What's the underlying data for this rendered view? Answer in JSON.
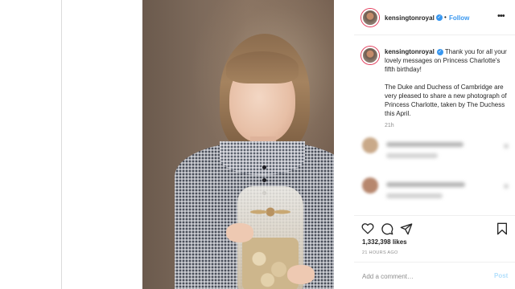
{
  "post": {
    "username": "kensingtonroyal",
    "follow_label": "Follow",
    "dot": "•",
    "more_label": "•••",
    "caption_p1": "Thank you for all your lovely messages on Princess Charlotte's fifth birthday!",
    "caption_p2": "The Duke and Duchess of Cambridge are very pleased to share a new photograph of Princess Charlotte, taken by The Duchess this April.",
    "caption_age": "21h",
    "likes": "1,332,398 likes",
    "posted_ago": "21 HOURS AGO",
    "comment_placeholder": "Add a comment…",
    "post_label": "Post"
  },
  "icons": {
    "verified": "verified-badge-icon",
    "like": "heart-icon",
    "comment": "speech-bubble-icon",
    "share": "paper-plane-icon",
    "save": "bookmark-icon",
    "more": "more-options-icon"
  },
  "colors": {
    "accent": "#3897f0",
    "text": "#262626",
    "muted": "#8e8e8e",
    "border": "#dbdbdb",
    "post_disabled": "#b2dffc"
  }
}
